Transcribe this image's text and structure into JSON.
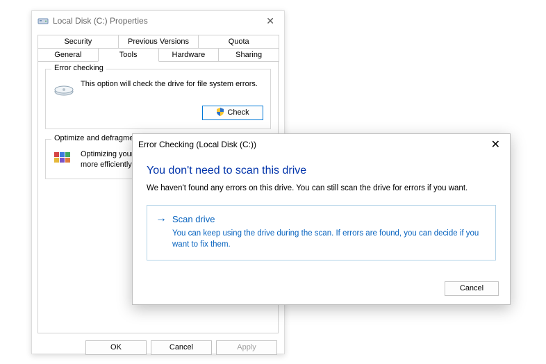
{
  "properties": {
    "title": "Local Disk (C:) Properties",
    "tabs_row1": [
      "Security",
      "Previous Versions",
      "Quota"
    ],
    "tabs_row2": [
      "General",
      "Tools",
      "Hardware",
      "Sharing"
    ],
    "active_tab": "Tools",
    "error_check_group": {
      "title": "Error checking",
      "desc": "This option will check the drive for file system errors.",
      "button": "Check"
    },
    "defrag_group": {
      "title": "Optimize and defragment drive",
      "desc": "Optimizing your computer's drives can help it run more efficiently."
    },
    "buttons": {
      "ok": "OK",
      "cancel": "Cancel",
      "apply": "Apply"
    }
  },
  "error_dialog": {
    "title": "Error Checking (Local Disk (C:))",
    "heading": "You don't need to scan this drive",
    "desc": "We haven't found any errors on this drive. You can still scan the drive for errors if you want.",
    "scan_title": "Scan drive",
    "scan_sub": "You can keep using the drive during the scan. If errors are found, you can decide if you want to fix them.",
    "cancel": "Cancel"
  }
}
